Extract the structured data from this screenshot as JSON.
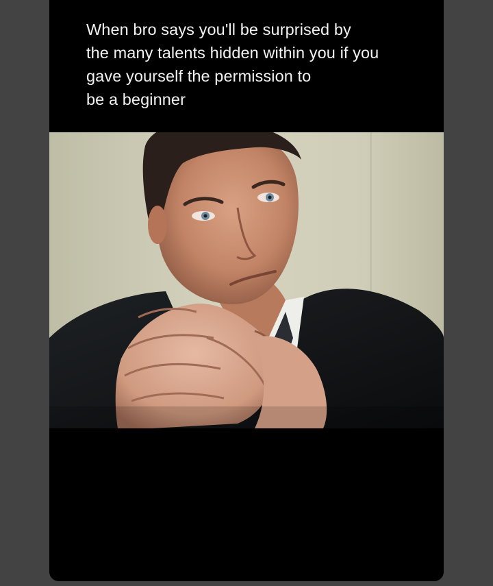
{
  "post": {
    "caption": "When bro says you'll be surprised by\nthe many talents hidden within you if you\ngave yourself the permission to\nbe a beginner"
  },
  "media": {
    "type": "video-still",
    "subject_icon": "man-in-suit-clasped-hands"
  },
  "colors": {
    "page_background": "#434343",
    "card_background": "#000000",
    "caption_text": "#f2f2f2"
  }
}
